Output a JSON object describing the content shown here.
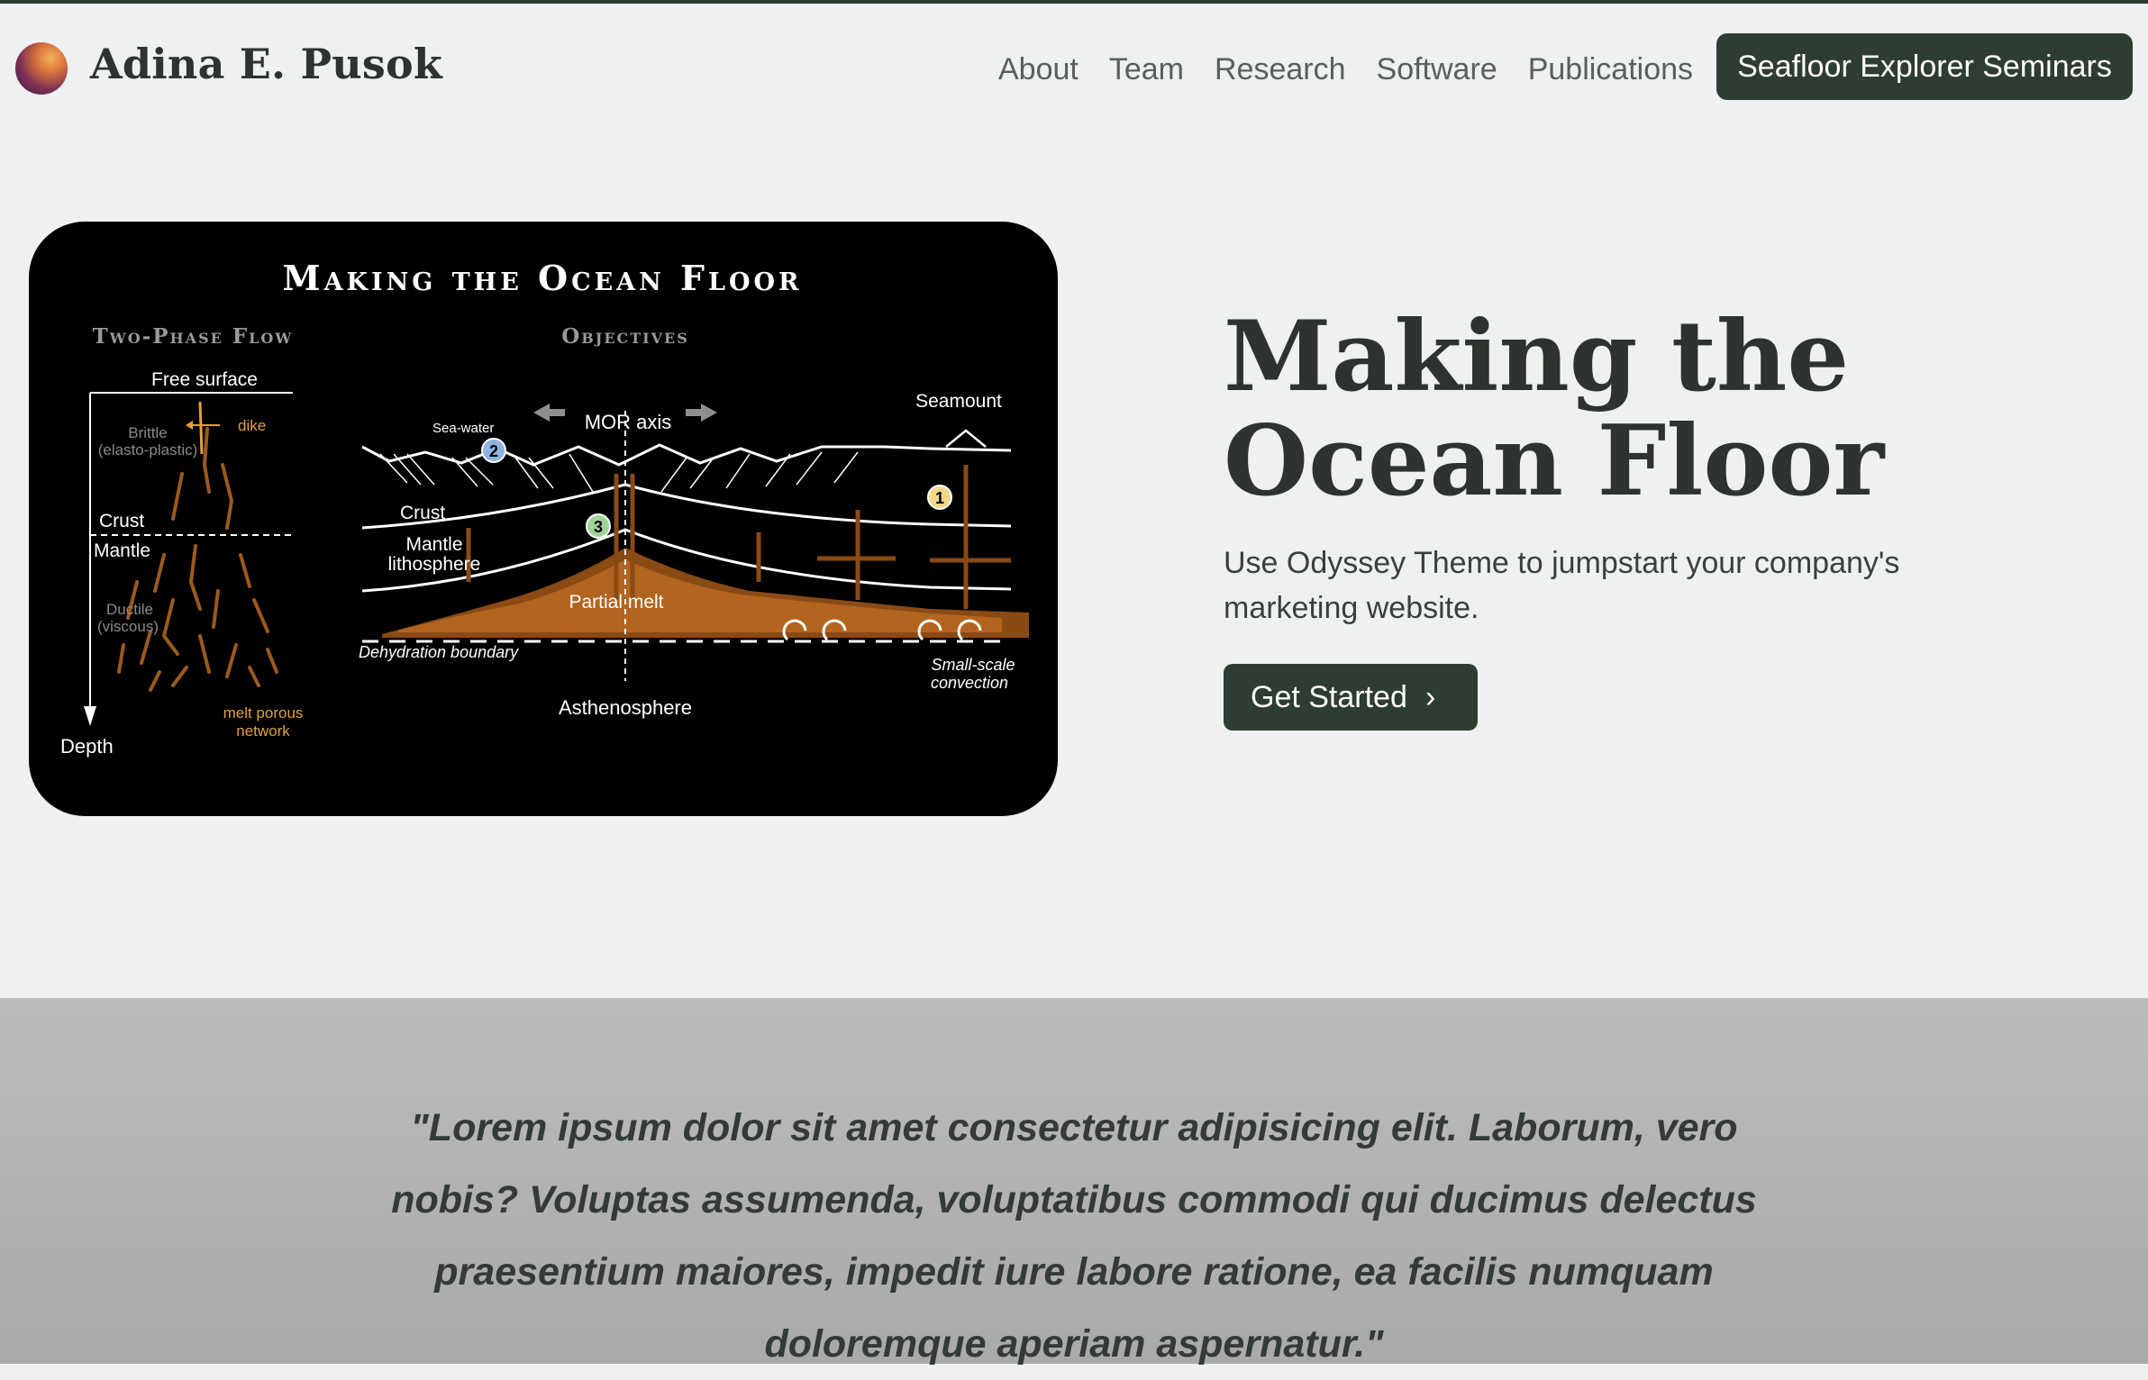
{
  "brand": {
    "name": "Adina E. Pusok",
    "logo_icon": "gradient-orb-icon"
  },
  "nav": {
    "items": [
      "About",
      "Team",
      "Research",
      "Software",
      "Publications"
    ],
    "cta_label": "Seafloor Explorer Seminars"
  },
  "hero": {
    "title": "Making the Ocean Floor",
    "subtitle": "Use Odyssey Theme to jumpstart your company's marketing website.",
    "button_label": "Get Started",
    "button_icon": "chevron-right-icon"
  },
  "figure": {
    "title": "Making the Ocean Floor",
    "left_heading": "Two-Phase Flow",
    "right_heading": "Objectives",
    "left_labels": {
      "free_surface": "Free surface",
      "brittle": "Brittle",
      "elasto_plastic": "(elasto-plastic)",
      "dike": "dike",
      "crust": "Crust",
      "mantle": "Mantle",
      "ductile": "Ductile",
      "viscous": "(viscous)",
      "melt_porous_1": "melt porous",
      "melt_porous_2": "network",
      "depth": "Depth"
    },
    "right_labels": {
      "sea_water": "Sea-water",
      "mor_axis": "MOR axis",
      "seamount": "Seamount",
      "crust": "Crust",
      "mantle": "Mantle",
      "lithosphere": "lithosphere",
      "partial_melt": "Partial melt",
      "dehydration": "Dehydration boundary",
      "small_scale_1": "Small-scale",
      "small_scale_2": "convection",
      "asthenosphere": "Asthenosphere",
      "marker_1": "1",
      "marker_2": "2",
      "marker_3": "3"
    }
  },
  "quote": {
    "text": "\"Lorem ipsum dolor sit amet consectetur adipisicing elit. Laborum, vero nobis? Voluptas assumenda, voluptatibus commodi qui ducimus delectus praesentium maiores, impedit iure labore ratione, ea facilis numquam doloremque aperiam aspernatur.\""
  },
  "colors": {
    "primary": "#2e3d31",
    "background": "#eef0f1",
    "band": "#b4b4b4",
    "melt_orange": "#b86a22"
  }
}
